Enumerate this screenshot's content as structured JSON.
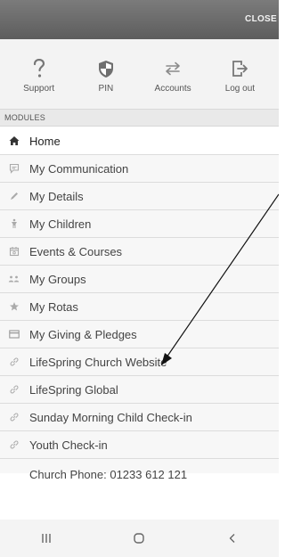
{
  "header": {
    "close_label": "CLOSE"
  },
  "actions": [
    {
      "label": "Support",
      "icon": "question-icon"
    },
    {
      "label": "PIN",
      "icon": "shield-icon"
    },
    {
      "label": "Accounts",
      "icon": "swap-icon"
    },
    {
      "label": "Log out",
      "icon": "logout-icon"
    }
  ],
  "modules": {
    "header": "MODULES",
    "items": [
      {
        "label": "Home",
        "icon": "home-icon"
      },
      {
        "label": "My Communication",
        "icon": "chat-icon"
      },
      {
        "label": "My Details",
        "icon": "pencil-icon"
      },
      {
        "label": "My Children",
        "icon": "child-icon"
      },
      {
        "label": "Events & Courses",
        "icon": "calendar-icon"
      },
      {
        "label": "My Groups",
        "icon": "group-icon"
      },
      {
        "label": "My Rotas",
        "icon": "star-icon"
      },
      {
        "label": "My Giving & Pledges",
        "icon": "card-icon"
      },
      {
        "label": "LifeSpring Church Website",
        "icon": "link-icon"
      },
      {
        "label": "LifeSpring Global",
        "icon": "link-icon"
      },
      {
        "label": "Sunday Morning Child Check-in",
        "icon": "link-icon"
      },
      {
        "label": "Youth Check-in",
        "icon": "link-icon"
      },
      {
        "label": "Church Phone: 01233 612 121",
        "icon": "link-icon"
      }
    ]
  },
  "navbar": [
    {
      "icon": "recent-apps-icon"
    },
    {
      "icon": "home-nav-icon"
    },
    {
      "icon": "back-icon"
    }
  ],
  "colors": {
    "topbar": "#6b6b6b",
    "active_row": "#ffffff",
    "row": "#f7f7f7",
    "icon_grey": "#9a9a9a"
  }
}
